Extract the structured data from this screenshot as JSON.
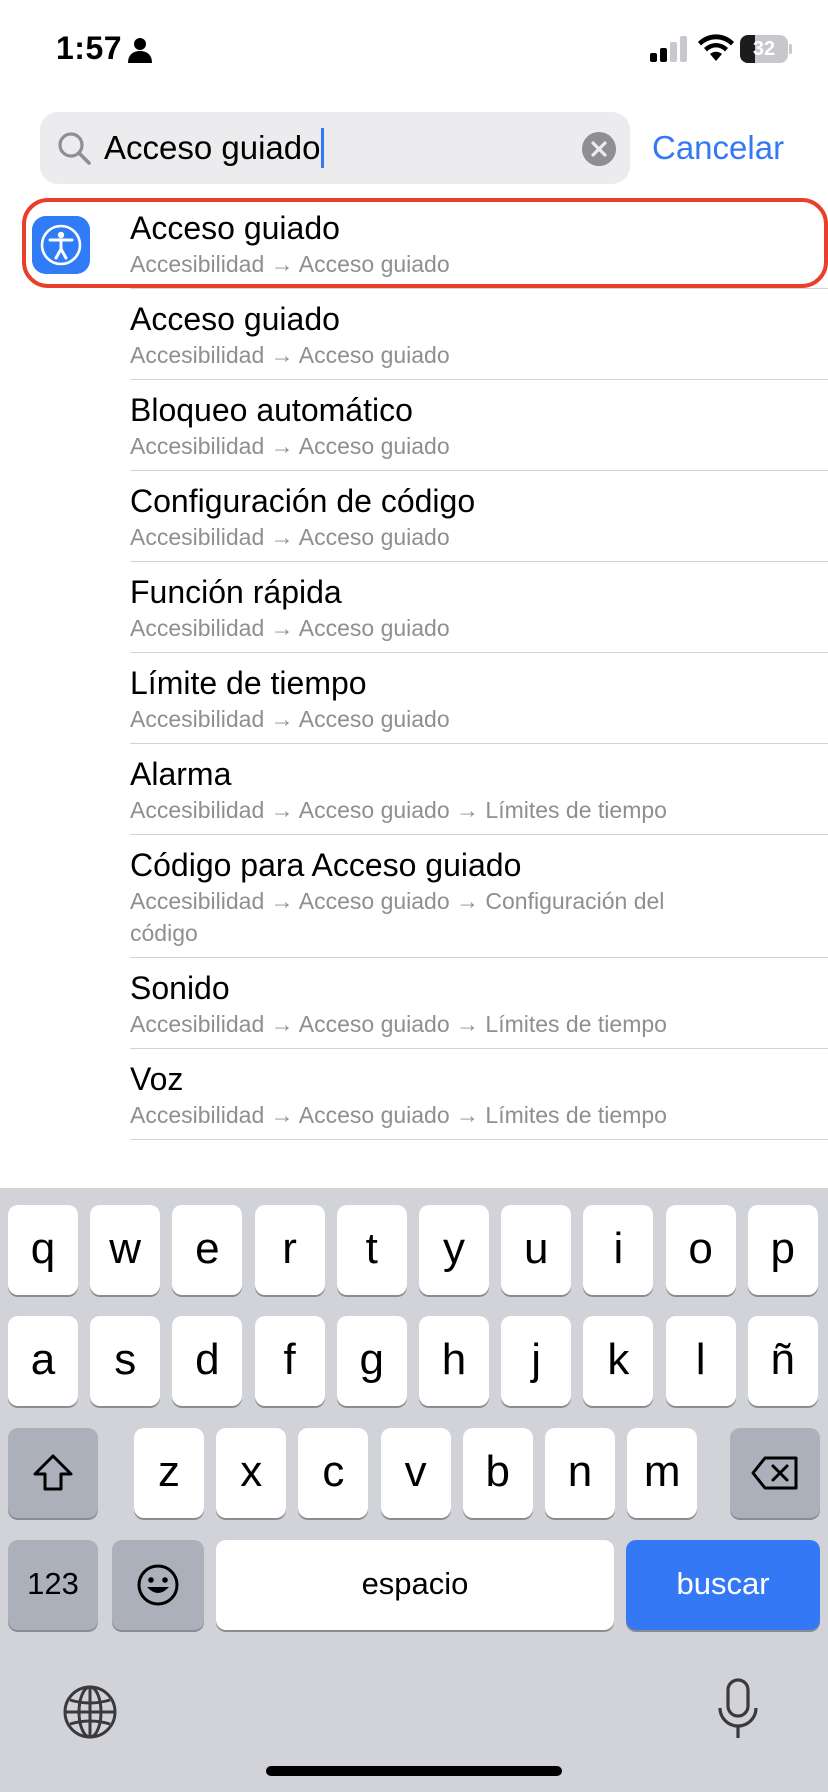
{
  "status_bar": {
    "time": "1:57",
    "battery_level": "32",
    "icons": [
      "person-icon",
      "signal-icon",
      "wifi-icon",
      "battery-icon"
    ]
  },
  "search": {
    "value": "Acceso guiado",
    "cancel_label": "Cancelar",
    "icons": [
      "search-icon",
      "clear-icon"
    ]
  },
  "results": [
    {
      "title": "Acceso guiado",
      "path": "Accesibilidad → Acceso guiado",
      "highlighted": true,
      "icon": "accessibility-icon"
    },
    {
      "title": "Acceso guiado",
      "path": "Accesibilidad → Acceso guiado"
    },
    {
      "title": "Bloqueo automático",
      "path": "Accesibilidad → Acceso guiado"
    },
    {
      "title": "Configuración de código",
      "path": "Accesibilidad → Acceso guiado"
    },
    {
      "title": "Función rápida",
      "path": "Accesibilidad → Acceso guiado"
    },
    {
      "title": "Límite de tiempo",
      "path": "Accesibilidad → Acceso guiado"
    },
    {
      "title": "Alarma",
      "path": "Accesibilidad → Acceso guiado → Límites de tiempo"
    },
    {
      "title": "Código para Acceso guiado",
      "path": "Accesibilidad → Acceso guiado → Configuración del código"
    },
    {
      "title": "Sonido",
      "path": "Accesibilidad → Acceso guiado → Límites de tiempo"
    },
    {
      "title": "Voz",
      "path": "Accesibilidad → Acceso guiado → Límites de tiempo"
    }
  ],
  "keyboard": {
    "row1": [
      "q",
      "w",
      "e",
      "r",
      "t",
      "y",
      "u",
      "i",
      "o",
      "p"
    ],
    "row2": [
      "a",
      "s",
      "d",
      "f",
      "g",
      "h",
      "j",
      "k",
      "l",
      "ñ"
    ],
    "row3": [
      "z",
      "x",
      "c",
      "v",
      "b",
      "n",
      "m"
    ],
    "numbers_label": "123",
    "space_label": "espacio",
    "search_label": "buscar",
    "icons": [
      "shift-icon",
      "backspace-icon",
      "emoji-icon",
      "globe-icon",
      "microphone-icon"
    ]
  },
  "colors": {
    "accent": "#3478f6",
    "highlight_border": "#e8402a",
    "keyboard_bg": "#d1d3d9"
  }
}
